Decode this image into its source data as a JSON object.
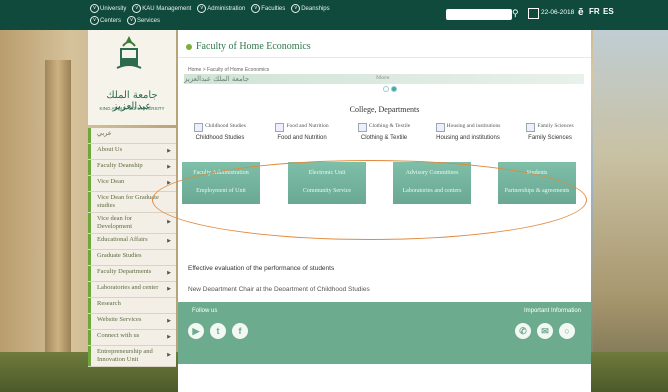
{
  "topbar": {
    "links": [
      "University",
      "KAU Management",
      "Administration",
      "Faculties",
      "Deanships",
      "Centers",
      "Services"
    ],
    "search_placeholder": "",
    "date": "22-06-2018",
    "lang_fr": "FR",
    "lang_es": "ES"
  },
  "sidebar": {
    "university_ar": "جامعة الملك عبدالعزيز",
    "university_en": "KING ABDULAZIZ UNIVERSITY",
    "items": [
      {
        "label": "عربي",
        "arrow": false
      },
      {
        "label": "About Us",
        "arrow": true
      },
      {
        "label": "Faculty Deanship",
        "arrow": true
      },
      {
        "label": "Vice Dean",
        "arrow": true
      },
      {
        "label": "Vice Dean for Graduate studies",
        "arrow": false
      },
      {
        "label": "Vice dean for Development",
        "arrow": true
      },
      {
        "label": "Educational Affairs",
        "arrow": true
      },
      {
        "label": "Graduate Studies",
        "arrow": false
      },
      {
        "label": "Faculty Departments",
        "arrow": true
      },
      {
        "label": "Laboratories and center",
        "arrow": true
      },
      {
        "label": "Research",
        "arrow": false
      },
      {
        "label": "Website Services",
        "arrow": true
      },
      {
        "label": "Connect with us",
        "arrow": true
      },
      {
        "label": "Entrepreneurship and Innovation Unit",
        "arrow": true
      }
    ]
  },
  "main": {
    "page_title": "Faculty of Home Economics",
    "breadcrumb": "Home > Faculty of Home Economics",
    "arabic_strip": "جامعة الملك عبدالعزيز",
    "more_label": "More",
    "section_title": "College, Departments",
    "departments": [
      {
        "title": "Childhood Studies",
        "sub": "Childhood Studies"
      },
      {
        "title": "Food and Nutrition",
        "sub": "Food and Nutrition"
      },
      {
        "title": "Clothing & Textile",
        "sub": "Clothing & Textile"
      },
      {
        "title": "Housing and institutions",
        "sub": "Housing and institutions"
      },
      {
        "title": "Family Sciences",
        "sub": "Family Sciences"
      }
    ],
    "tiles": [
      {
        "top": "Faculty Administration",
        "bottom": "Employment of Unit"
      },
      {
        "top": "Electronic Unit",
        "bottom": "Community Service"
      },
      {
        "top": "Advisory Committees",
        "bottom": "Laboratories and centers"
      },
      {
        "top": "Students",
        "bottom": "Partnerships & agreements"
      }
    ],
    "news": [
      "Effective evaluation of the performance of students",
      "New Department Chair at the Department of Childhood Studies"
    ],
    "footer": {
      "follow_label": "Follow us",
      "important_label": "Important Information"
    }
  },
  "colors": {
    "topbar": "#0f4a3c",
    "accent_green": "#6cab8e",
    "annotation": "#e08a3e"
  }
}
